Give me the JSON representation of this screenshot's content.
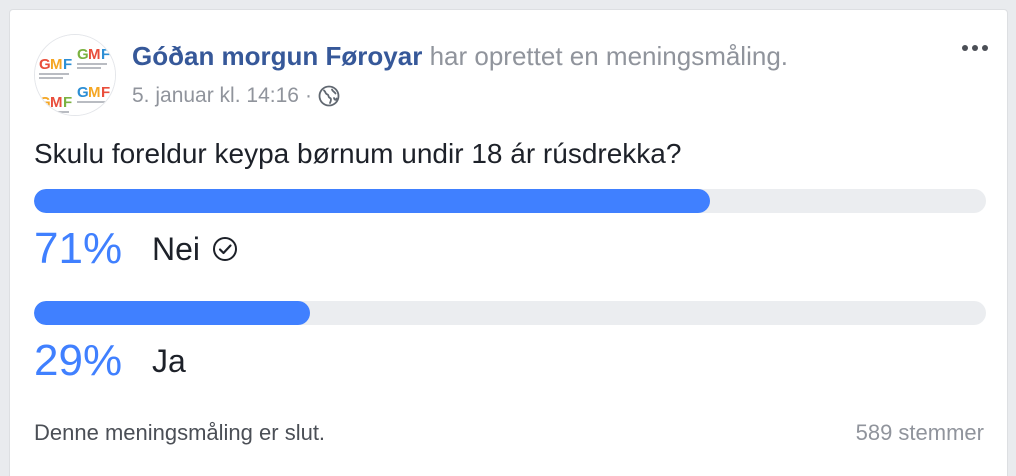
{
  "post": {
    "author": "Góðan morgun Føroyar",
    "action": "har oprettet en meningsmåling.",
    "date": "5. januar kl. 14:16",
    "separator": "·",
    "privacy_icon": "globe-icon",
    "menu_icon": "more-options-icon"
  },
  "avatar": {
    "logo_text": "GMF",
    "brand_colors": [
      "#e94e3c",
      "#f5a623",
      "#7bb241",
      "#2d8fd5"
    ]
  },
  "poll": {
    "question": "Skulu foreldur keypa børnum undir 18 ár rúsdrekka?",
    "options": [
      {
        "percent_label": "71%",
        "percent": 71,
        "label": "Nei",
        "voted": true,
        "voted_icon": "checkmark-circle-icon"
      },
      {
        "percent_label": "29%",
        "percent": 29,
        "label": "Ja",
        "voted": false
      }
    ],
    "status": "Denne meningsmåling er slut.",
    "votes": "589 stemmer"
  },
  "colors": {
    "accent": "#4080ff",
    "bar_track": "#ebedf0",
    "author_link": "#365899",
    "muted_text": "#90949c"
  }
}
